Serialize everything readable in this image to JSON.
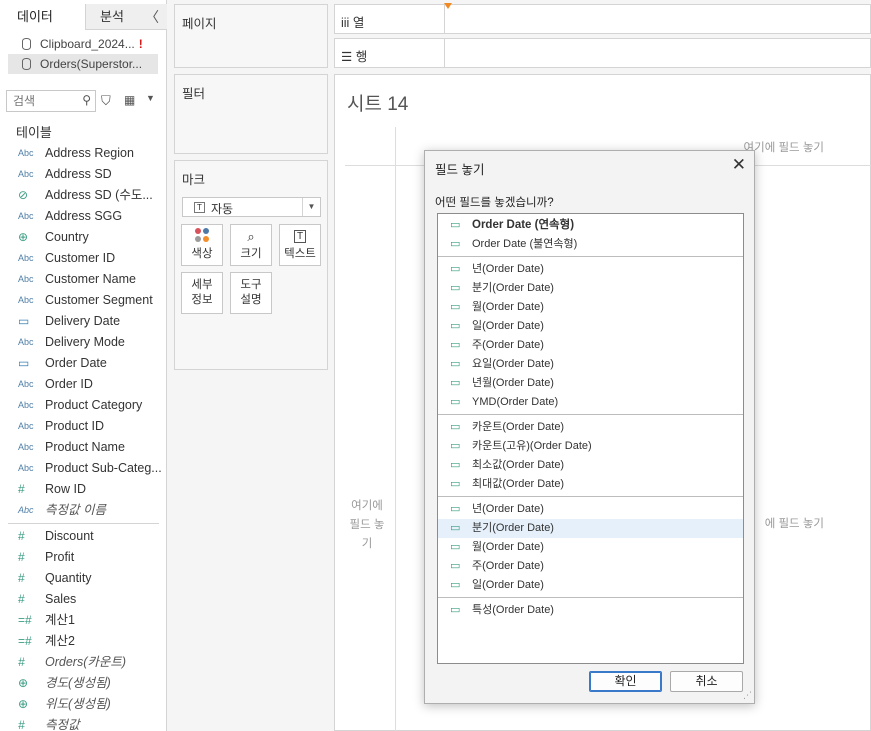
{
  "data_pane": {
    "tab_data": "데이터",
    "tab_analysis": "분석",
    "collapse_glyph": "〈",
    "sources": [
      {
        "label": "Clipboard_2024...",
        "warning": "!"
      },
      {
        "label": "Orders(Superstor..."
      }
    ],
    "search_placeholder": "검색",
    "tables_title": "테이블",
    "fields_dimensions": [
      {
        "icon": "Abc",
        "label": "Address Region"
      },
      {
        "icon": "Abc",
        "label": "Address SD"
      },
      {
        "icon": "link",
        "label": "Address SD (수도..."
      },
      {
        "icon": "Abc",
        "label": "Address SGG"
      },
      {
        "icon": "globe",
        "label": "Country"
      },
      {
        "icon": "Abc",
        "label": "Customer ID"
      },
      {
        "icon": "Abc",
        "label": "Customer Name"
      },
      {
        "icon": "Abc",
        "label": "Customer Segment"
      },
      {
        "icon": "cal",
        "label": "Delivery Date"
      },
      {
        "icon": "Abc",
        "label": "Delivery Mode"
      },
      {
        "icon": "cal",
        "label": "Order Date"
      },
      {
        "icon": "Abc",
        "label": "Order ID"
      },
      {
        "icon": "Abc",
        "label": "Product Category"
      },
      {
        "icon": "Abc",
        "label": "Product ID"
      },
      {
        "icon": "Abc",
        "label": "Product Name"
      },
      {
        "icon": "Abc",
        "label": "Product Sub-Categ..."
      },
      {
        "icon": "#",
        "label": "Row ID"
      },
      {
        "icon": "Abc",
        "label": "측정값 이름",
        "italic": true
      }
    ],
    "fields_measures": [
      {
        "icon": "#",
        "label": "Discount"
      },
      {
        "icon": "#",
        "label": "Profit"
      },
      {
        "icon": "#",
        "label": "Quantity"
      },
      {
        "icon": "#",
        "label": "Sales"
      },
      {
        "icon": "=#",
        "label": "계산1"
      },
      {
        "icon": "=#",
        "label": "계산2"
      },
      {
        "icon": "#",
        "label": "Orders(카운트)",
        "italic": true
      },
      {
        "icon": "globe",
        "label": "경도(생성됨)",
        "italic": true
      },
      {
        "icon": "globe",
        "label": "위도(생성됨)",
        "italic": true
      },
      {
        "icon": "#",
        "label": "측정값",
        "italic": true
      }
    ]
  },
  "cards": {
    "pages": "페이지",
    "filters": "필터",
    "marks": "마크",
    "mark_type": "자동",
    "mark_buttons": [
      "색상",
      "크기",
      "텍스트",
      "세부\n정보",
      "도구\n설명"
    ]
  },
  "shelves": {
    "columns": "열",
    "rows": "행"
  },
  "sheet": {
    "title": "시트 14",
    "drop_col": "여기에 필드 놓기",
    "drop_row": "여기에 필드 놓기",
    "drop_mid": "에 필드 놓기"
  },
  "dialog": {
    "title": "필드 놓기",
    "question": "어떤 필드를 놓겠습니까?",
    "groups": [
      [
        {
          "label": "Order Date (연속형)",
          "bold": true
        },
        {
          "label": "Order Date (불연속형)"
        }
      ],
      [
        {
          "label": "년(Order Date)"
        },
        {
          "label": "분기(Order Date)"
        },
        {
          "label": "월(Order Date)"
        },
        {
          "label": "일(Order Date)"
        },
        {
          "label": "주(Order Date)"
        },
        {
          "label": "요일(Order Date)"
        },
        {
          "label": "년월(Order Date)"
        },
        {
          "label": "YMD(Order Date)"
        }
      ],
      [
        {
          "label": "카운트(Order Date)"
        },
        {
          "label": "카운트(고유)(Order Date)"
        },
        {
          "label": "최소값(Order Date)"
        },
        {
          "label": "최대값(Order Date)"
        }
      ],
      [
        {
          "label": "년(Order Date)"
        },
        {
          "label": "분기(Order Date)",
          "selected": true
        },
        {
          "label": "월(Order Date)"
        },
        {
          "label": "주(Order Date)"
        },
        {
          "label": "일(Order Date)"
        }
      ],
      [
        {
          "label": "특성(Order Date)"
        }
      ]
    ],
    "ok": "확인",
    "cancel": "취소"
  },
  "colors": {
    "accent_blue": "#3a79c9",
    "selection": "#e5f0fb",
    "warning": "#d31b1b",
    "field_green": "#3a9c82"
  }
}
